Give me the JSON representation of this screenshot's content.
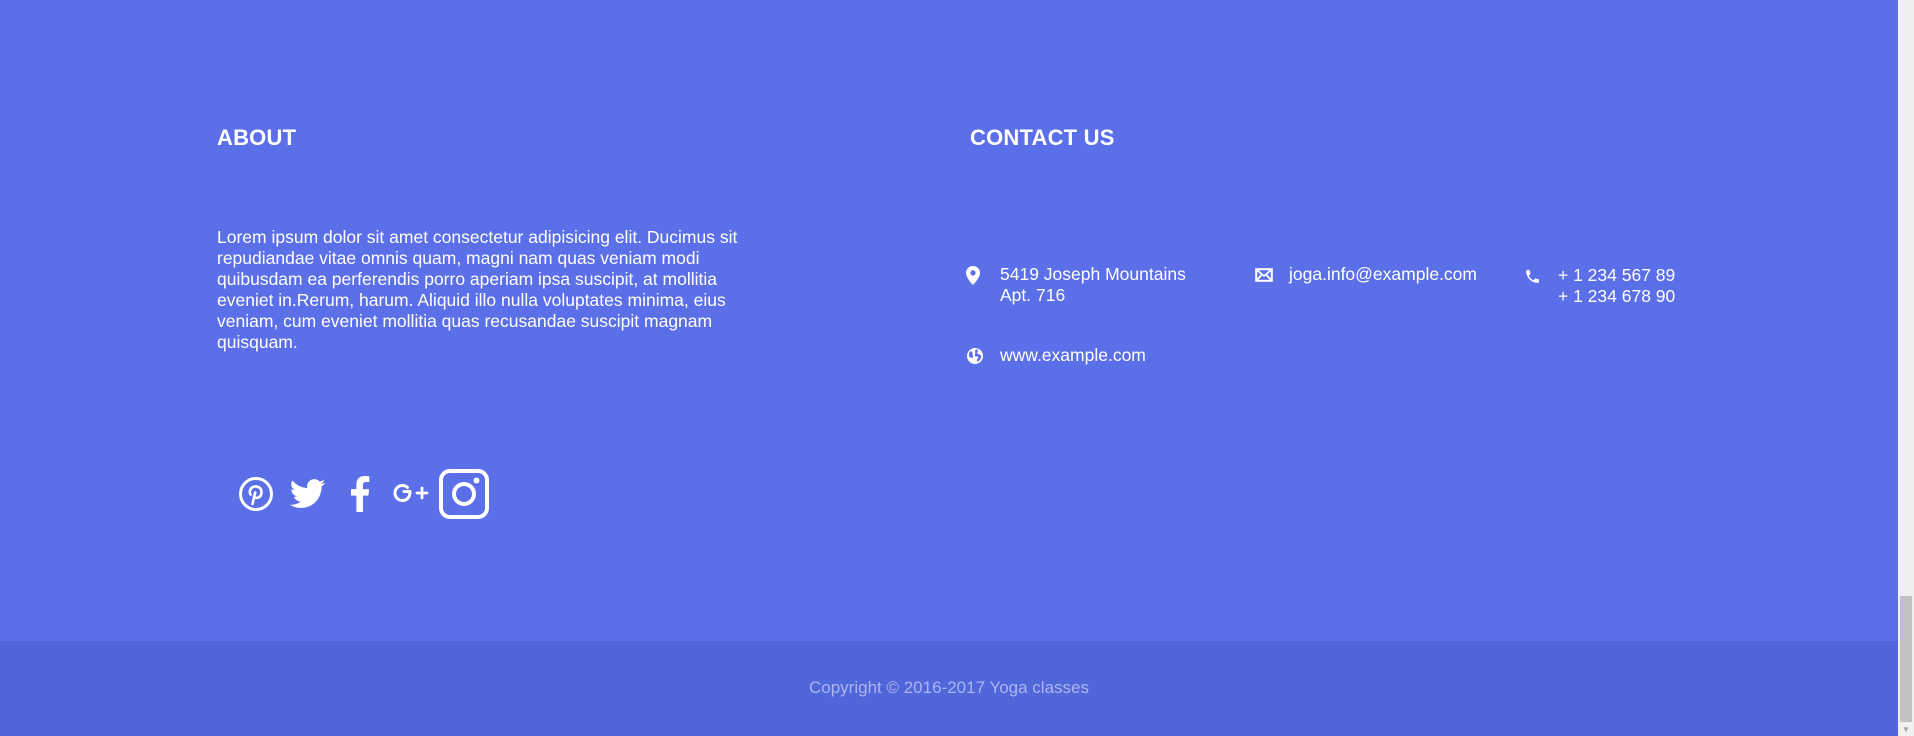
{
  "about": {
    "heading": "ABOUT",
    "text": "Lorem ipsum dolor sit amet consectetur adipisicing elit. Ducimus sit repudiandae vitae omnis quam, magni nam quas veniam modi quibusdam ea perferendis porro aperiam ipsa suscipit, at mollitia eveniet in.Rerum, harum. Aliquid illo nulla voluptates minima, eius veniam, cum eveniet mollitia quas recusandae suscipit magnam quisquam."
  },
  "contact": {
    "heading": "CONTACT US",
    "address_line1": "5419 Joseph Mountains",
    "address_line2": "Apt. 716",
    "email": "joga.info@example.com",
    "phone1": "+ 1 234 567 89",
    "phone2": "+ 1 234 678 90",
    "website": "www.example.com"
  },
  "socials": [
    "pinterest-icon",
    "twitter-icon",
    "facebook-icon",
    "google-plus-icon",
    "instagram-icon"
  ],
  "footer": {
    "copyright": "Copyright © 2016-2017 Yoga classes"
  },
  "colors": {
    "background": "#5b6fe9",
    "bottom_bar": "#5166d8",
    "text": "#ffffff",
    "copyright_text": "#aab6f3"
  }
}
